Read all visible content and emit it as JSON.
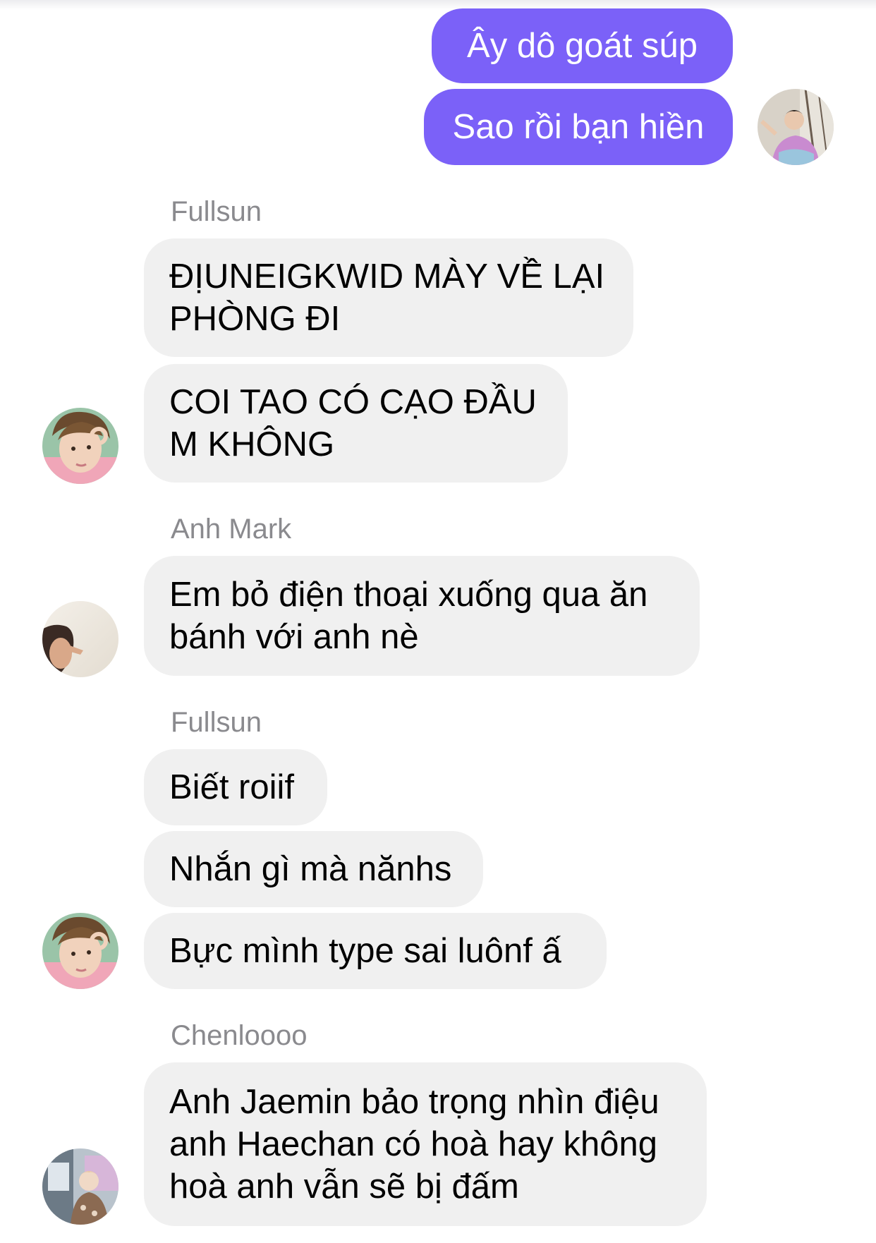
{
  "outgoing": {
    "messages": [
      "Ây dô goát súp",
      "Sao rồi bạn hiền"
    ]
  },
  "groups": [
    {
      "sender": "Fullsun",
      "messages": [
        [
          "ĐỊUNEIGKWID MÀY VỀ LẠI",
          "PHÒNG ĐI"
        ],
        [
          "COI TAO CÓ CẠO ĐẦU",
          "M KHÔNG"
        ]
      ]
    },
    {
      "sender": "Anh Mark",
      "messages": [
        [
          "Em bỏ điện thoại xuống qua ăn",
          "bánh với anh nè"
        ]
      ]
    },
    {
      "sender": "Fullsun",
      "messages": [
        [
          "Biết roiif"
        ],
        [
          "Nhắn gì mà nănhs"
        ],
        [
          "Bực mình type sai luônf ấ"
        ]
      ]
    },
    {
      "sender": "Chenloooo",
      "messages": [
        [
          "Anh Jaemin bảo trọng nhìn điệu",
          "anh Haechan có hoà hay không",
          "hoà anh vẫn sẽ bị đấm"
        ]
      ]
    }
  ],
  "colors": {
    "outgoing_bubble": "#7b61f8",
    "incoming_bubble": "#f0f0f0",
    "sender_name": "#8a8a8e"
  }
}
